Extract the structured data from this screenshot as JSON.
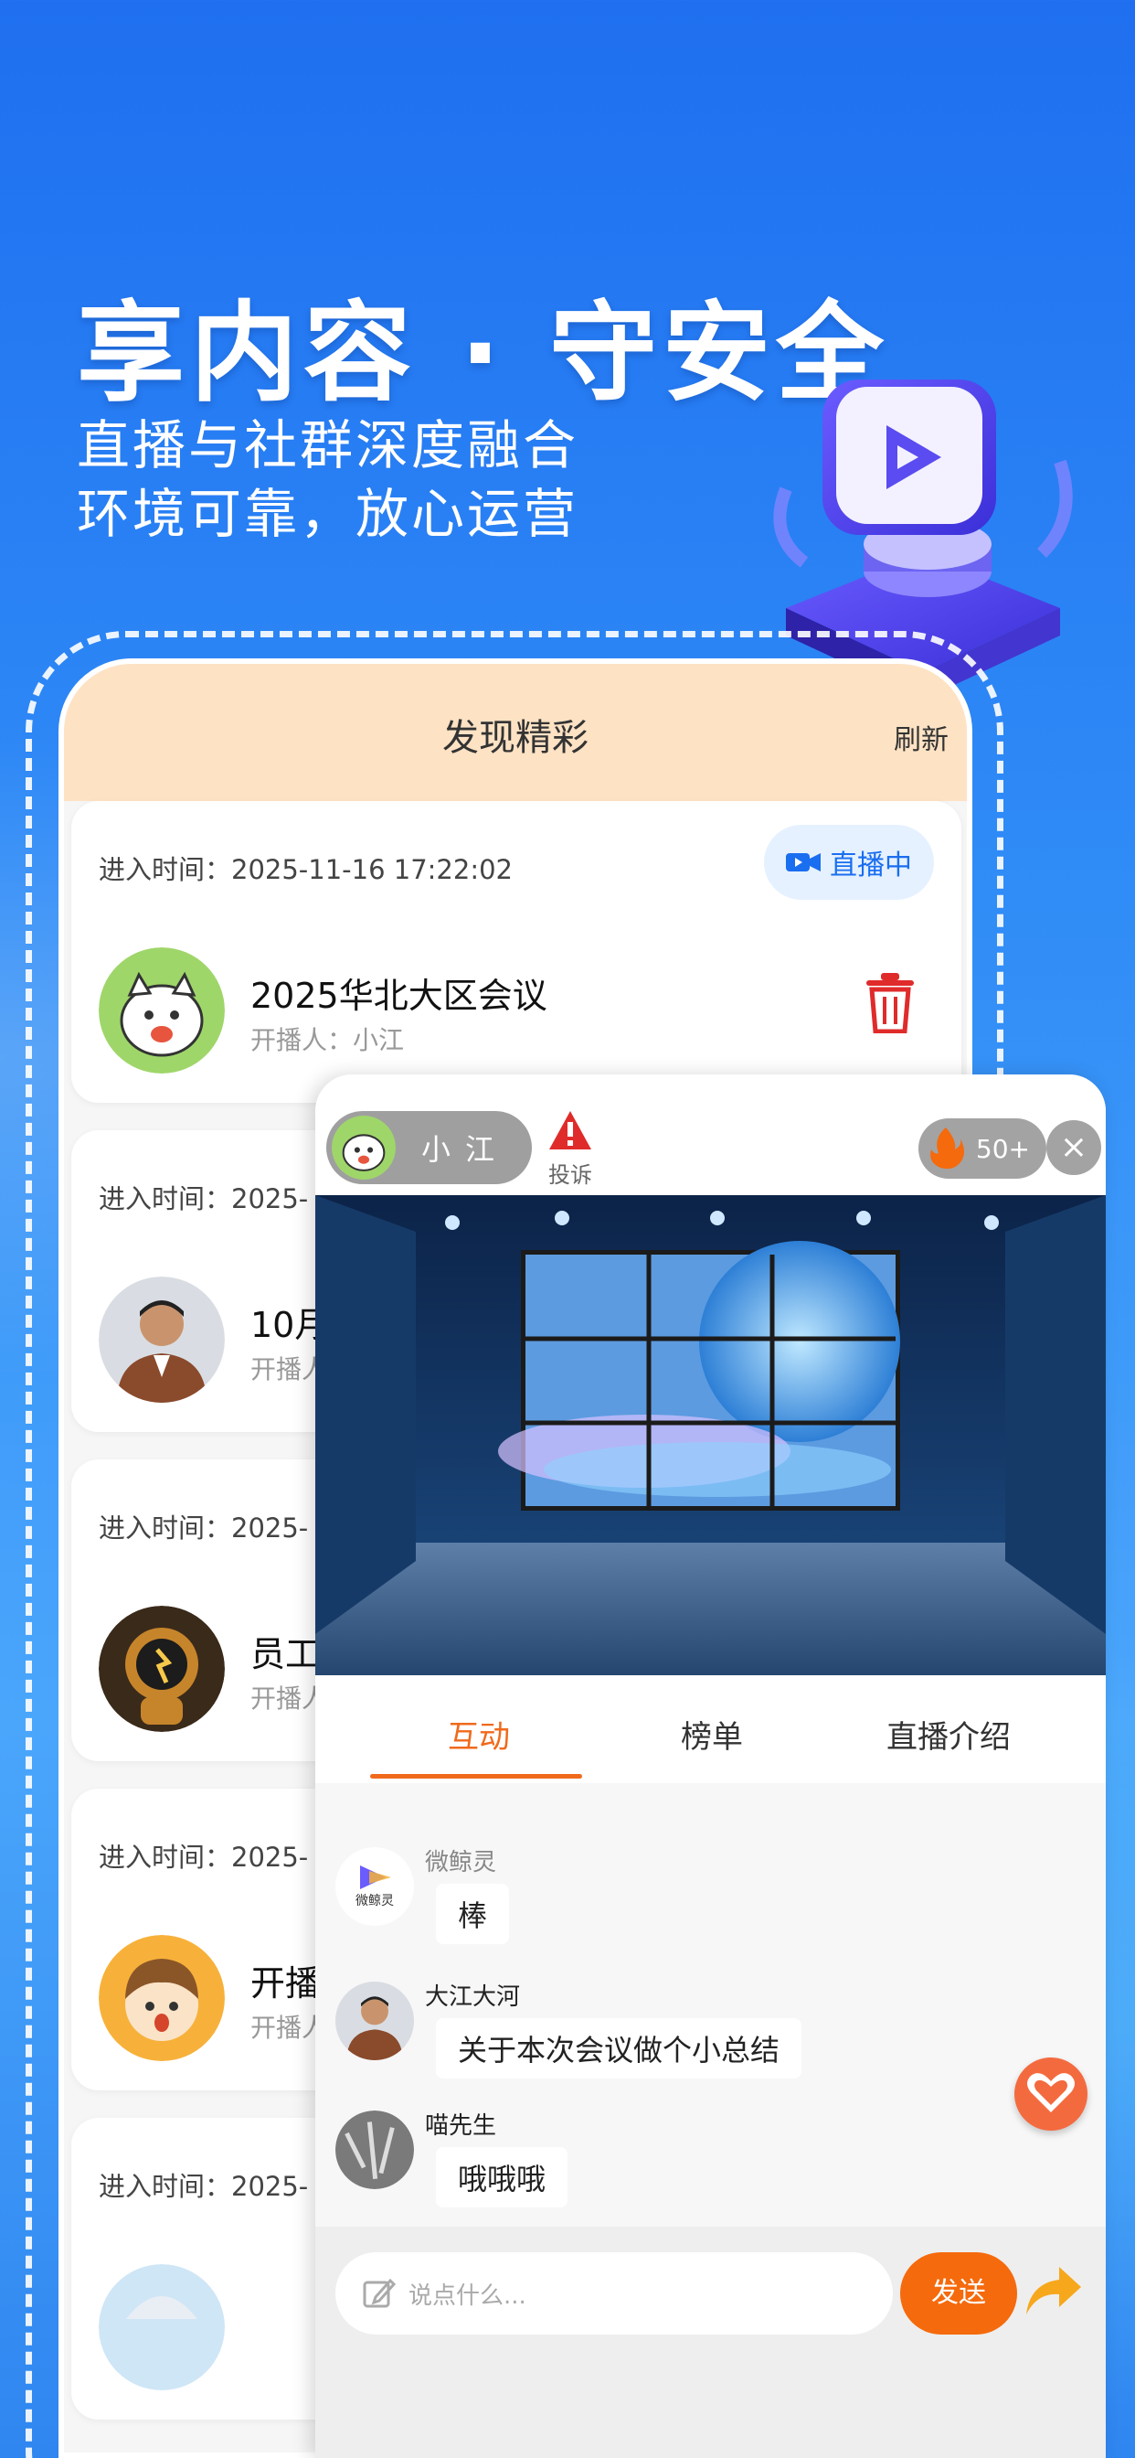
{
  "hero": {
    "title": "享内容 · 守安全",
    "subtitle_line1": "直播与社群深度融合",
    "subtitle_line2": "环境可靠，放心运营"
  },
  "discover": {
    "title": "发现精彩",
    "refresh_label": "刷新",
    "time_prefix": "进入时间：",
    "cards": [
      {
        "time": "进入时间：2025-11-16 17:22:02",
        "name": "2025华北大区会议",
        "host": "开播人：小江",
        "live_label": "直播中"
      },
      {
        "time": "进入时间：2025-",
        "name": "10月",
        "host": "开播人"
      },
      {
        "time": "进入时间：2025-",
        "name": "员工",
        "host": "开播人"
      },
      {
        "time": "进入时间：2025-",
        "name": "开播",
        "host": "开播人"
      },
      {
        "time": "进入时间：2025-",
        "name": "",
        "host": ""
      }
    ]
  },
  "live_room": {
    "host_name": "小江",
    "report_label": "投诉",
    "heat_count": "50+",
    "close_symbol": "×",
    "tabs": [
      {
        "label": "互动",
        "active": true
      },
      {
        "label": "榜单",
        "active": false
      },
      {
        "label": "直播介绍",
        "active": false
      }
    ],
    "messages": [
      {
        "nick": "微鲸灵",
        "text": "棒"
      },
      {
        "nick": "大江大河",
        "text": "关于本次会议做个小总结"
      },
      {
        "nick": "喵先生",
        "text": "哦哦哦"
      }
    ],
    "logo_text": "微鲸灵",
    "input_placeholder": "说点什么...",
    "send_label": "发送"
  },
  "colors": {
    "accent_orange": "#f06a1c",
    "live_blue": "#1a6ef0",
    "header_peach": "#fde2c4"
  }
}
